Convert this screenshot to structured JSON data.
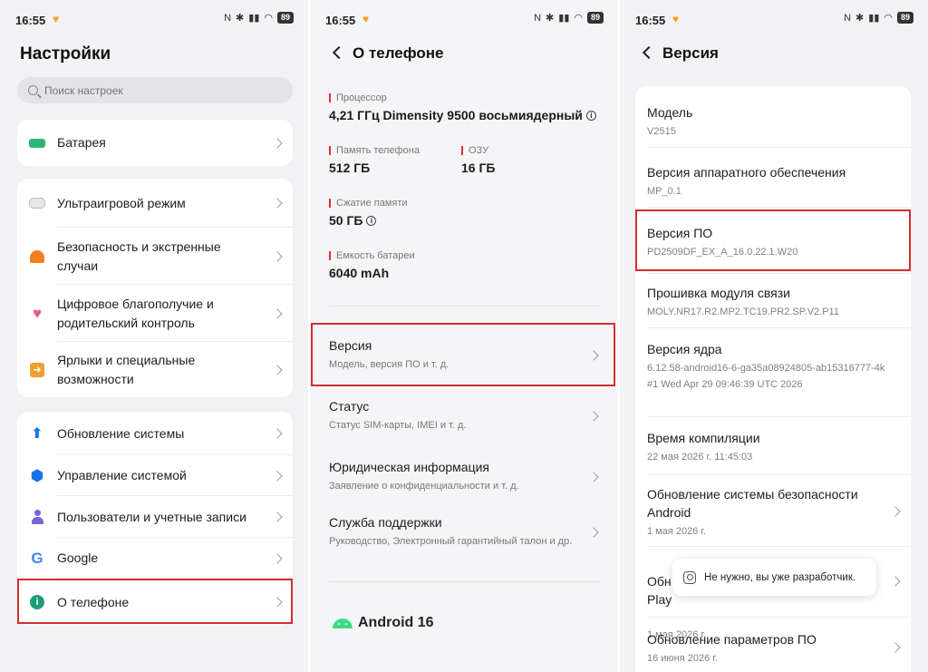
{
  "status": {
    "time": "16:55",
    "battery": "89"
  },
  "settings": {
    "title": "Настройки",
    "search_placeholder": "Поиск настроек",
    "battery_label": "Батарея",
    "group2": [
      {
        "label": "Ультраигровой режим"
      },
      {
        "label": "Безопасность и экстренные случаи"
      },
      {
        "label": "Цифровое благополучие и родительский контроль"
      },
      {
        "label": "Ярлыки и специальные возможности"
      }
    ],
    "group3": [
      {
        "label": "Обновление системы"
      },
      {
        "label": "Управление системой"
      },
      {
        "label": "Пользователи и учетные записи"
      },
      {
        "label": "Google"
      },
      {
        "label": "О телефоне"
      }
    ]
  },
  "about": {
    "title": "О телефоне",
    "processor_label": "Процессор",
    "processor_value": "4,21 ГГц Dimensity 9500 восьмиядерный",
    "storage_label": "Память телефона",
    "storage_value": "512 ГБ",
    "ram_label": "ОЗУ",
    "ram_value": "16 ГБ",
    "compression_label": "Сжатие памяти",
    "compression_value": "50 ГБ",
    "battery_cap_label": "Емкость батареи",
    "battery_cap_value": "6040 mAh",
    "items": [
      {
        "title": "Версия",
        "subtitle": "Модель, версия ПО и т. д."
      },
      {
        "title": "Статус",
        "subtitle": "Статус SIM-карты, IMEI и т. д."
      },
      {
        "title": "Юридическая информация",
        "subtitle": "Заявление о конфиденциальности и т. д."
      },
      {
        "title": "Служба поддержки",
        "subtitle": "Руководство, Электронный гарантийный талон и др."
      }
    ],
    "android_label": "Android 16"
  },
  "version": {
    "title": "Версия",
    "items": [
      {
        "title": "Модель",
        "value": "V2515"
      },
      {
        "title": "Версия аппаратного обеспечения",
        "value": "MP_0.1"
      },
      {
        "title": "Версия ПО",
        "value": "PD2509DF_EX_A_16.0.22.1.W20"
      },
      {
        "title": "Прошивка модуля связи",
        "value": "MOLY.NR17.R2.MP2.TC19.PR2.SP.V2.P11"
      },
      {
        "title": "Версия ядра",
        "value": "6.12.58-android16-6-ga35a08924805-ab15316777-4k",
        "value2": "#1 Wed Apr 29 09:46:39 UTC 2026"
      },
      {
        "title": "Время компиляции",
        "value": "22 мая 2026 г. 11:45:03"
      },
      {
        "title": "Обновление системы безопасности Android",
        "value": "1 мая 2026 г."
      },
      {
        "title": "Обн\nPlay",
        "value": "1 мая 2026 г."
      },
      {
        "title": "Обновление параметров ПО",
        "value": "16 июня 2026 г."
      }
    ],
    "toast": "Не нужно, вы уже разработчик."
  },
  "colors": {
    "highlight": "#d62d2d",
    "accent_red": "#e03030"
  }
}
